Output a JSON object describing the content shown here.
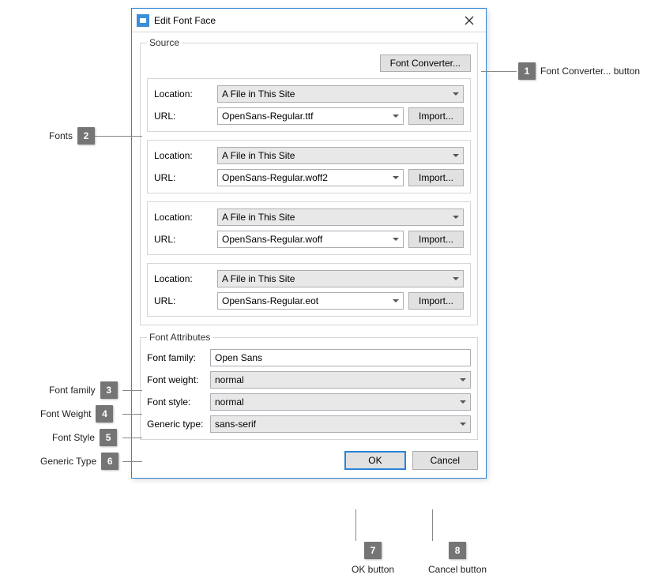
{
  "dialog": {
    "title": "Edit Font Face"
  },
  "source": {
    "legend": "Source",
    "converter_button": "Font Converter...",
    "location_label": "Location:",
    "url_label": "URL:",
    "import_label": "Import...",
    "location_value": "A File in This Site",
    "fonts": [
      {
        "url": "OpenSans-Regular.ttf"
      },
      {
        "url": "OpenSans-Regular.woff2"
      },
      {
        "url": "OpenSans-Regular.woff"
      },
      {
        "url": "OpenSans-Regular.eot"
      }
    ]
  },
  "attrs": {
    "legend": "Font Attributes",
    "family_label": "Font family:",
    "family_value": "Open Sans",
    "weight_label": "Font weight:",
    "weight_value": "normal",
    "style_label": "Font style:",
    "style_value": "normal",
    "generic_label": "Generic type:",
    "generic_value": "sans-serif"
  },
  "footer": {
    "ok": "OK",
    "cancel": "Cancel"
  },
  "annotations": {
    "a1": {
      "num": "1",
      "text": "Font Converter... button"
    },
    "a2": {
      "num": "2",
      "text": "Fonts"
    },
    "a3": {
      "num": "3",
      "text": "Font family"
    },
    "a4": {
      "num": "4",
      "text": "Font Weight"
    },
    "a5": {
      "num": "5",
      "text": "Font Style"
    },
    "a6": {
      "num": "6",
      "text": "Generic Type"
    },
    "a7": {
      "num": "7",
      "text": "OK button"
    },
    "a8": {
      "num": "8",
      "text": "Cancel button"
    }
  }
}
